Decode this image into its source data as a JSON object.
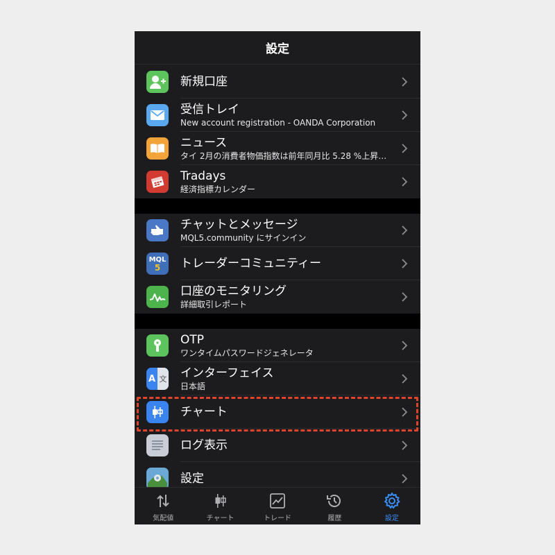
{
  "header": {
    "title": "設定"
  },
  "sections": [
    [
      {
        "title": "新規口座",
        "icon": "add-user-icon",
        "color": "#5cc35d"
      },
      {
        "title": "受信トレイ",
        "sub": "New account registration - OANDA Corporation",
        "icon": "mail-icon",
        "color": "#5aa9f0"
      },
      {
        "title": "ニュース",
        "sub": "タイ 2月の消費者物価指数は前年同月比 5.28 %上昇…",
        "icon": "book-icon",
        "color": "#f2a33a"
      },
      {
        "title": "Tradays",
        "sub": "経済指標カレンダー",
        "icon": "calendar-icon",
        "color": "#d23b32"
      }
    ],
    [
      {
        "title": "チャットとメッセージ",
        "sub": "MQL5.community にサインイン",
        "icon": "chat-hand-icon",
        "color": "#4a78c6"
      },
      {
        "title": "トレーダーコミュニティー",
        "icon": "mql5-icon",
        "color": "#3f6fb8",
        "icon_text": "MQL",
        "icon_text2": "5"
      },
      {
        "title": "口座のモニタリング",
        "sub": "詳細取引レポート",
        "icon": "monitoring-chart-icon",
        "color": "#4cb34d"
      }
    ],
    [
      {
        "title": "OTP",
        "sub": "ワンタイムパスワードジェネレータ",
        "icon": "key-icon",
        "color": "#5cc35d"
      },
      {
        "title": "インターフェイス",
        "sub": "日本語",
        "icon": "translate-icon",
        "color": "#3a84ef",
        "icon_text": "A",
        "icon_text2": "文"
      },
      {
        "title": "チャート",
        "icon": "candlestick-icon",
        "color": "#3a84ef"
      },
      {
        "title": "ログ表示",
        "icon": "log-document-icon",
        "color": "#c8cdd6"
      },
      {
        "title": "設定",
        "icon": "settings-app-icon",
        "color": "#6aa9d6"
      }
    ]
  ],
  "tabs": [
    {
      "label": "気配値",
      "icon": "quotes-arrows-icon"
    },
    {
      "label": "チャート",
      "icon": "chart-candles-icon"
    },
    {
      "label": "トレード",
      "icon": "trade-icon"
    },
    {
      "label": "履歴",
      "icon": "history-icon"
    },
    {
      "label": "設定",
      "icon": "gear-icon",
      "active": true
    }
  ],
  "colors": {
    "accent": "#3a8ef6",
    "highlight": "#e0452b"
  }
}
